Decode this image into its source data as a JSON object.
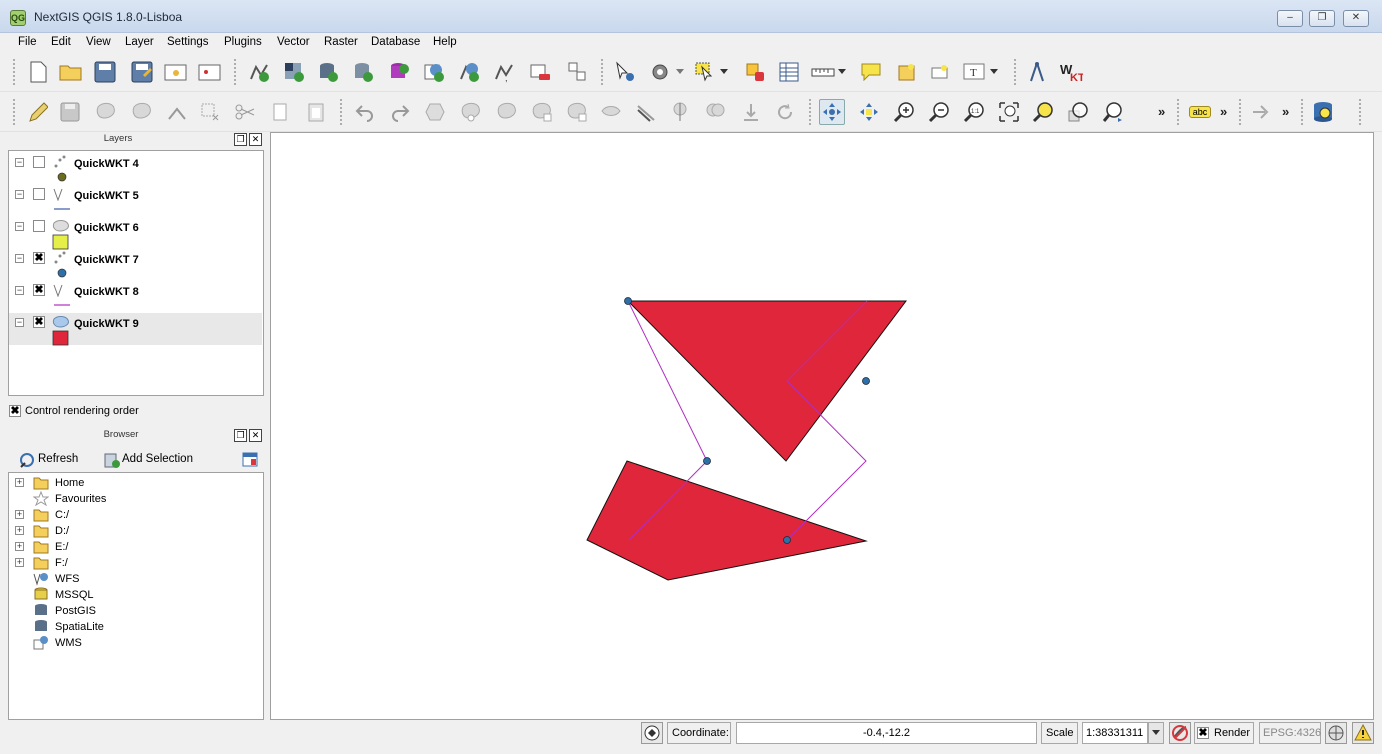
{
  "window": {
    "title": "NextGIS QGIS 1.8.0-Lisboa",
    "app_icon_text": "QG",
    "minimize": "‒",
    "maximize": "❐",
    "close": "✕"
  },
  "menu": [
    "File",
    "Edit",
    "View",
    "Layer",
    "Settings",
    "Plugins",
    "Vector",
    "Raster",
    "Database",
    "Help"
  ],
  "toolbar1_icons": [
    "new-project",
    "open-project",
    "save-project",
    "save-as",
    "new-print-composer",
    "composer-manager",
    "add-vector-layer",
    "add-raster-layer",
    "add-postgis-layer",
    "add-spatialite-layer",
    "add-mssql-layer",
    "add-wms-layer",
    "add-wfs-layer",
    "add-delimited-text-layer",
    "new-shapefile-layer",
    "remove-layer",
    "georeferencer",
    "identify",
    "action",
    "select-features",
    "deselect",
    "open-attribute-table",
    "measure",
    "map-tips",
    "new-bookmark",
    "show-bookmarks",
    "text-annotation",
    "compass",
    "quickwkt"
  ],
  "toolbar2_icons": [
    "toggle-editing",
    "save-edits",
    "add-feature",
    "move-feature",
    "node-tool",
    "delete-selected",
    "cut-features",
    "copy-features",
    "paste-features",
    "undo",
    "redo",
    "simplify",
    "add-ring",
    "add-part",
    "delete-ring",
    "delete-part",
    "reshape",
    "offset-curve",
    "split-features",
    "merge-features",
    "merge-attributes",
    "rotate-point",
    "pan",
    "pan-to-selection",
    "zoom-in",
    "zoom-out",
    "zoom-actual",
    "zoom-full",
    "zoom-to-selection",
    "zoom-to-layer",
    "zoom-last"
  ],
  "toolbar2_extra": {
    "more1": "»",
    "label_chip": "abc",
    "more2": "»",
    "more3": "»"
  },
  "layers_panel": {
    "title": "Layers",
    "float": "❐",
    "close": "✕",
    "layers": [
      {
        "name": "QuickWKT 4",
        "checked": false,
        "type": "point",
        "color": "#6b6b1f"
      },
      {
        "name": "QuickWKT 5",
        "checked": false,
        "type": "line",
        "color": "#3b5aa8"
      },
      {
        "name": "QuickWKT 6",
        "checked": false,
        "type": "polygon",
        "color": "#e6ee4a"
      },
      {
        "name": "QuickWKT 7",
        "checked": true,
        "type": "point",
        "color": "#2f6fa8"
      },
      {
        "name": "QuickWKT 8",
        "checked": true,
        "type": "line",
        "color": "#b02ec0"
      },
      {
        "name": "QuickWKT 9",
        "checked": true,
        "type": "polygon",
        "color": "#e0263a"
      }
    ],
    "render_order_label": "Control rendering order",
    "check_mark": "✖"
  },
  "browser_panel": {
    "title": "Browser",
    "float": "❐",
    "close": "✕",
    "refresh": "Refresh",
    "add_selection": "Add Selection",
    "items": [
      {
        "label": "Home",
        "icon": "folder",
        "expandable": true
      },
      {
        "label": "Favourites",
        "icon": "star",
        "expandable": false
      },
      {
        "label": "C:/",
        "icon": "folder",
        "expandable": true
      },
      {
        "label": "D:/",
        "icon": "folder",
        "expandable": true
      },
      {
        "label": "E:/",
        "icon": "folder",
        "expandable": true
      },
      {
        "label": "F:/",
        "icon": "folder",
        "expandable": true
      },
      {
        "label": "WFS",
        "icon": "wfs",
        "expandable": false
      },
      {
        "label": "MSSQL",
        "icon": "db",
        "expandable": false
      },
      {
        "label": "PostGIS",
        "icon": "db",
        "expandable": false
      },
      {
        "label": "SpatiaLite",
        "icon": "db",
        "expandable": false
      },
      {
        "label": "WMS",
        "icon": "wms",
        "expandable": false
      }
    ]
  },
  "status": {
    "coordinate_label": "Coordinate:",
    "coordinate_value": "-0.4,-12.2",
    "scale_label": "Scale",
    "scale_value": "1:38331311",
    "render_label": "Render",
    "render_checked": true,
    "crs": "EPSG:4326"
  },
  "colors": {
    "polygon_fill": "#e0263a",
    "line": "#b02ec0",
    "point": "#2f6fa8"
  }
}
